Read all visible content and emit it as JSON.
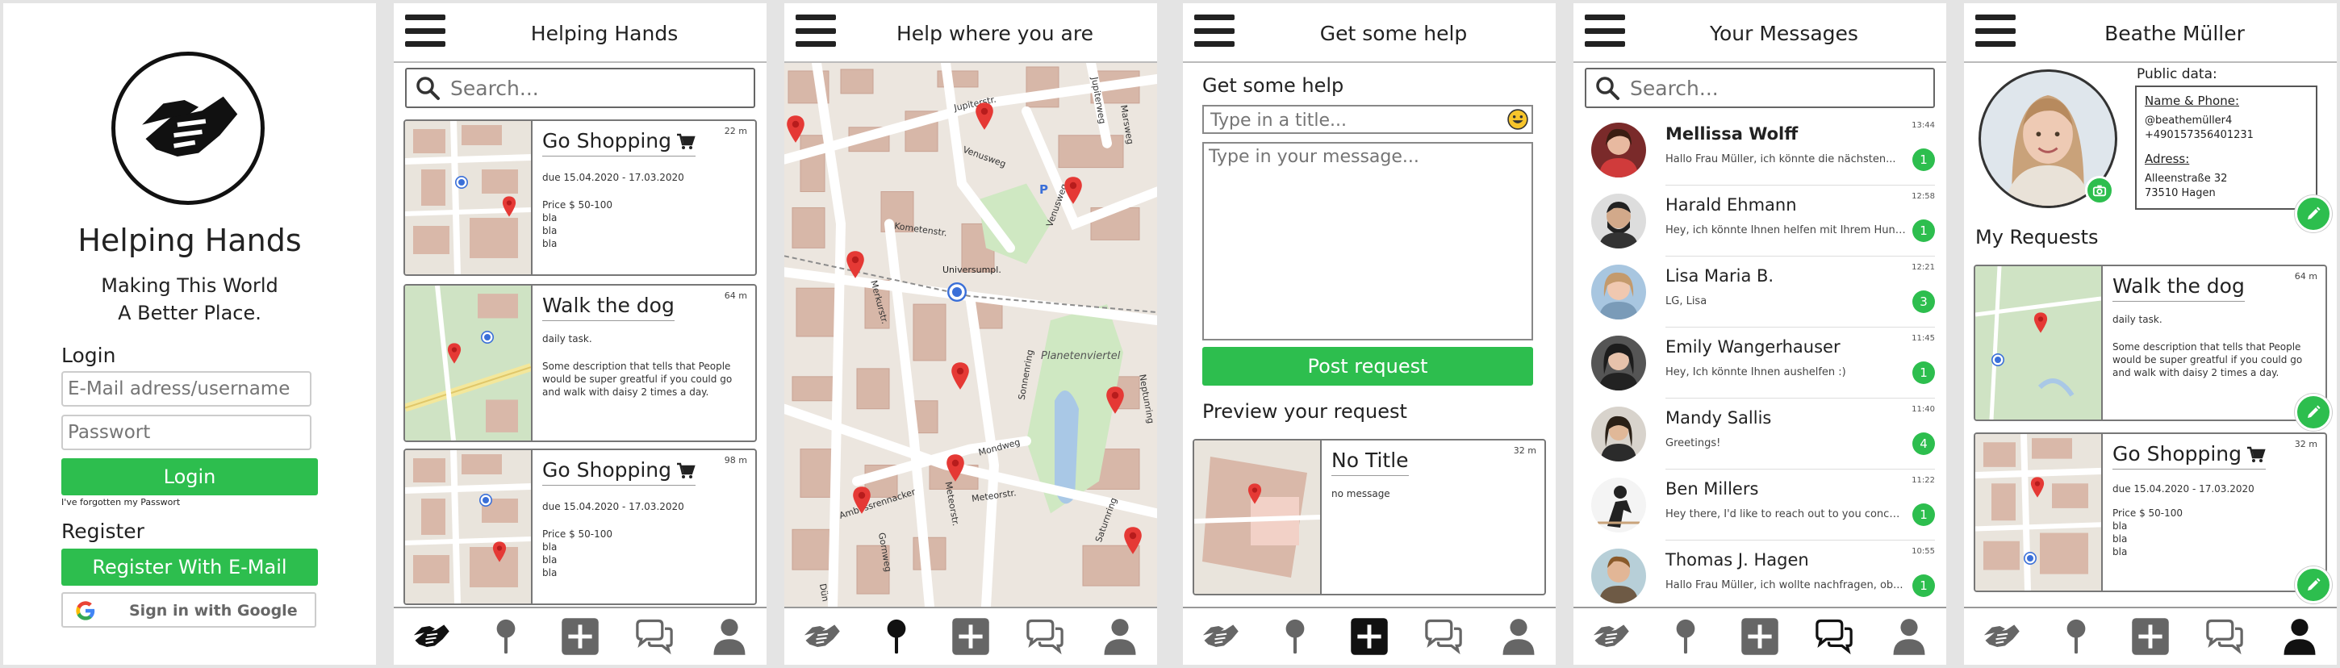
{
  "login": {
    "app_name": "Helping Hands",
    "tagline_1": "Making This World",
    "tagline_2": "A Better Place.",
    "login_heading": "Login",
    "email_placeholder": "E-Mail adress/username",
    "password_placeholder": "Passwort",
    "login_button": "Login",
    "forgot": "I've forgotten my Passwort",
    "register_heading": "Register",
    "register_email_button": "Register With E-Mail",
    "google_button": "Sign in with Google",
    "accent": "#2dbe4e"
  },
  "feed": {
    "title": "Helping Hands",
    "search_placeholder": "Search...",
    "cards": [
      {
        "title": "Go Shopping",
        "icon": "cart-icon",
        "distance": "22 m",
        "line1": "due 15.04.2020 - 17.03.2020",
        "price": "Price $ 50-100",
        "extra": [
          "bla",
          "bla",
          "bla"
        ]
      },
      {
        "title": "Walk the dog",
        "distance": "64 m",
        "line1": "daily task.",
        "desc": "Some description that tells that People would be super greatful if you could go and walk with daisy 2 times a day."
      },
      {
        "title": "Go Shopping",
        "icon": "cart-icon",
        "distance": "98 m",
        "line1": "due 15.04.2020 - 17.03.2020",
        "price": "Price $ 50-100",
        "extra": [
          "bla",
          "bla",
          "bla"
        ]
      }
    ]
  },
  "map": {
    "title": "Help where you are",
    "streets": [
      "Jupiterstr.",
      "Venusweg",
      "Jupiterweg",
      "Marsweg",
      "Kometenstr.",
      "Universumpl.",
      "Merkurstr.",
      "Venusweg",
      "Sonnenring",
      "Planetenviertel",
      "Neptunring",
      "Mondweg",
      "Meteorstr.",
      "Meteorstr.",
      "Ambossrennacker",
      "Saturnring",
      "Gornweg",
      "Dün"
    ],
    "parking": "P"
  },
  "request": {
    "title": "Get some help",
    "section": "Get some help",
    "title_placeholder": "Type in a title...",
    "message_placeholder": "Type in your message...",
    "post_button": "Post request",
    "preview_heading": "Preview your request",
    "preview_title": "No Title",
    "preview_distance": "32 m",
    "preview_message": "no message"
  },
  "messages": {
    "title": "Your Messages",
    "search_placeholder": "Search...",
    "items": [
      {
        "name": "Mellissa Wolff",
        "preview": "Hallo Frau Müller, ich könnte die nächsten...",
        "time": "13:44",
        "count": "1",
        "bold": true
      },
      {
        "name": "Harald Ehmann",
        "preview": "Hey, ich könnte Ihnen helfen mit Ihrem Hund...",
        "time": "12:58",
        "count": "1"
      },
      {
        "name": "Lisa Maria B.",
        "preview": "LG, Lisa",
        "time": "12:21",
        "count": "3"
      },
      {
        "name": "Emily Wangerhauser",
        "preview": " Hey, Ich könnte Ihnen aushelfen :)",
        "time": "11:45",
        "count": "1"
      },
      {
        "name": "Mandy Sallis",
        "preview": "Greetings!",
        "time": "11:40",
        "count": "4"
      },
      {
        "name": "Ben Millers",
        "preview": "Hey there, I'd like to reach out to you concer...",
        "time": "11:22",
        "count": "1"
      },
      {
        "name": "Thomas J. Hagen",
        "preview": "Hallo Frau Müller, ich wollte nachfragen, ob...",
        "time": "10:55",
        "count": "1"
      }
    ]
  },
  "profile": {
    "title": "Beathe Müller",
    "public_data": "Public data:",
    "name_phone_label": "Name & Phone:",
    "handle": "@beathemüller4",
    "phone": "+490157356401231",
    "address_label": "Adress:",
    "street": "Alleenstraße 32",
    "city": "73510 Hagen",
    "requests_heading": "My Requests",
    "cards": [
      {
        "title": "Walk the dog",
        "distance": "64 m",
        "line1": "daily task.",
        "desc": "Some description that tells that People would be super greatful if you could go and walk with daisy 2 times a day."
      },
      {
        "title": "Go Shopping",
        "icon": "cart-icon",
        "distance": "32 m",
        "line1": "due 15.04.2020 - 17.03.2020",
        "price": "Price $ 50-100",
        "extra": [
          "bla",
          "bla",
          "bla"
        ]
      }
    ]
  },
  "nav_icons": [
    "hands-icon",
    "map-pin-icon",
    "add-icon",
    "chat-icon",
    "person-icon"
  ]
}
